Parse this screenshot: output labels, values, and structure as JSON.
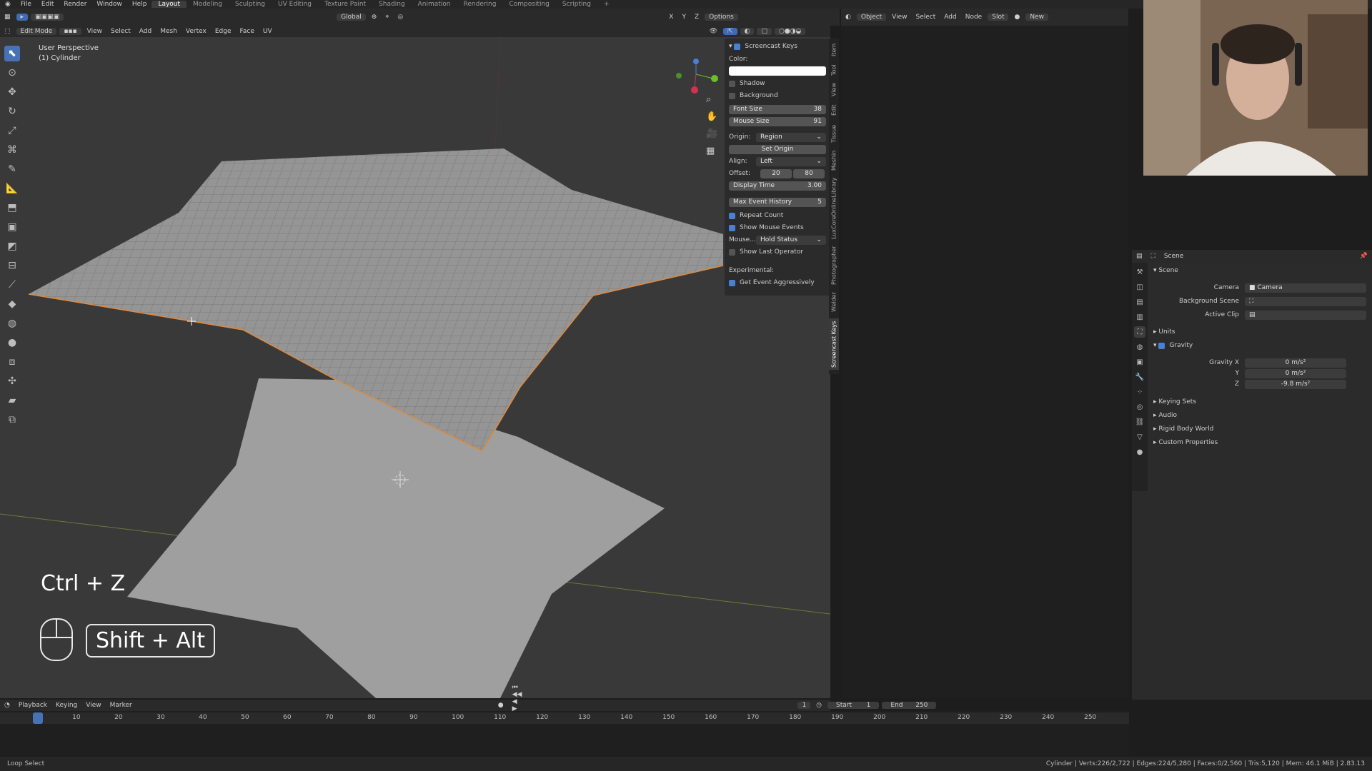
{
  "topbar": {
    "menus": [
      "File",
      "Edit",
      "Render",
      "Window",
      "Help"
    ],
    "workspaces": [
      "Layout",
      "Modeling",
      "Sculpting",
      "UV Editing",
      "Texture Paint",
      "Shading",
      "Animation",
      "Rendering",
      "Compositing",
      "Scripting"
    ],
    "active_workspace": "Layout",
    "add_tab": "+"
  },
  "header": {
    "transform_orientation": "Global",
    "options_label": "Options",
    "axes": [
      "X",
      "Y",
      "Z"
    ]
  },
  "viewport_header": {
    "mode": "Edit Mode",
    "menus": [
      "View",
      "Select",
      "Add",
      "Mesh",
      "Vertex",
      "Edge",
      "Face",
      "UV"
    ]
  },
  "viewport": {
    "perspective": "User Perspective",
    "object": "(1) Cylinder"
  },
  "screencast": {
    "key1": "Ctrl + Z",
    "key2": "Shift + Alt"
  },
  "npanel": {
    "title": "Screencast Keys",
    "color_label": "Color:",
    "shadow": "Shadow",
    "background": "Background",
    "font_size_label": "Font Size",
    "font_size": "38",
    "mouse_size_label": "Mouse Size",
    "mouse_size": "91",
    "origin_label": "Origin:",
    "origin_value": "Region",
    "set_origin": "Set Origin",
    "align_label": "Align:",
    "align_value": "Left",
    "offset_label": "Offset:",
    "offset_x": "20",
    "offset_y": "80",
    "display_time_label": "Display Time",
    "display_time": "3.00",
    "max_event_label": "Max Event History",
    "max_event": "5",
    "repeat_count": "Repeat Count",
    "show_mouse_events": "Show Mouse Events",
    "mouse_label": "Mouse...",
    "mouse_value": "Hold Status",
    "show_last_operator": "Show Last Operator",
    "experimental": "Experimental:",
    "get_event": "Get Event Aggressively",
    "tabs": [
      "Item",
      "Tool",
      "View",
      "Edit",
      "Tissue",
      "Meshin",
      "LuxCoreOnlineLibrary",
      "Photographer",
      "Welder",
      "Screencast Keys"
    ]
  },
  "node_header": {
    "object_label": "Object",
    "menus": [
      "View",
      "Select",
      "Add",
      "Node"
    ],
    "slot": "Slot",
    "new_label": "New"
  },
  "properties": {
    "scene_name": "Scene",
    "section_scene": "Scene",
    "camera_label": "Camera",
    "camera_value": "Camera",
    "background_scene": "Background Scene",
    "active_clip": "Active Clip",
    "units": "Units",
    "gravity": "Gravity",
    "gravity_x_label": "Gravity X",
    "gravity_x": "0 m/s²",
    "gravity_y_label": "Y",
    "gravity_y": "0 m/s²",
    "gravity_z_label": "Z",
    "gravity_z": "-9.8 m/s²",
    "keying_sets": "Keying Sets",
    "audio": "Audio",
    "rigid_body": "Rigid Body World",
    "custom_props": "Custom Properties"
  },
  "timeline": {
    "menus": [
      "Playback",
      "Keying",
      "View",
      "Marker"
    ],
    "current_frame": "1",
    "start_label": "Start",
    "start": "1",
    "end_label": "End",
    "end": "250",
    "ticks": [
      "1",
      "10",
      "20",
      "30",
      "40",
      "50",
      "60",
      "70",
      "80",
      "90",
      "100",
      "110",
      "120",
      "130",
      "140",
      "150",
      "160",
      "170",
      "180",
      "190",
      "200",
      "210",
      "220",
      "230",
      "240",
      "250"
    ]
  },
  "statusbar": {
    "left": "Loop Select",
    "right": "Cylinder | Verts:226/2,722 | Edges:224/5,280 | Faces:0/2,560 | Tris:5,120 | Mem: 46.1 MiB | 2.83.13"
  },
  "colors": {
    "accent": "#4772b3",
    "mesh_face": "#9e9e9e",
    "selected_edge": "#e08a3c"
  }
}
